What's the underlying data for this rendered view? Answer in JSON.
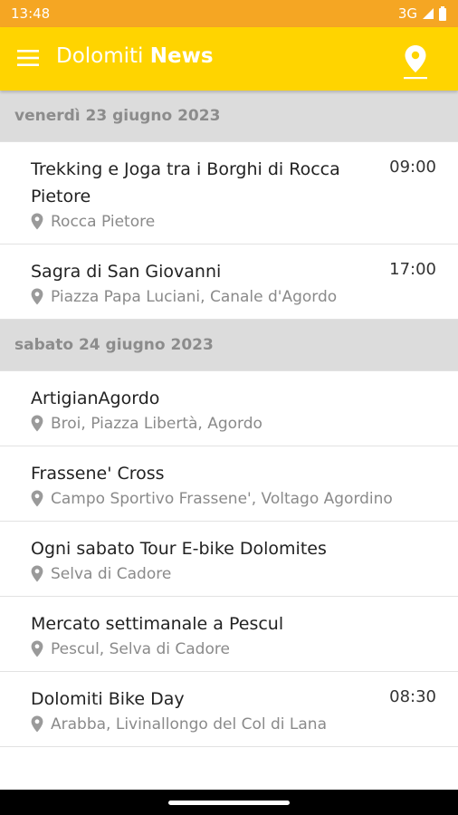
{
  "status_bar": {
    "time": "13:48",
    "network": "3G"
  },
  "app_bar": {
    "title_regular": "Dolomiti",
    "title_bold": "News"
  },
  "colors": {
    "status_bar": "#f5a623",
    "app_bar": "#ffd400",
    "date_header_bg": "#dcdcdc",
    "date_header_text": "#8c8c8c"
  },
  "icons": {
    "menu": "hamburger-menu-icon",
    "location": "location-pin-icon",
    "event_location": "map-marker-icon"
  },
  "sections": [
    {
      "date": "venerdì 23 giugno 2023",
      "events": [
        {
          "title": "Trekking e Joga tra i Borghi di Rocca Pietore",
          "time": "09:00",
          "location": "Rocca Pietore"
        },
        {
          "title": "Sagra di San Giovanni",
          "time": "17:00",
          "location": "Piazza Papa Luciani, Canale d'Agordo"
        }
      ]
    },
    {
      "date": "sabato 24 giugno 2023",
      "events": [
        {
          "title": "ArtigianAgordo",
          "time": "",
          "location": "Broi, Piazza Libertà, Agordo"
        },
        {
          "title": "Frassene' Cross",
          "time": "",
          "location": "Campo Sportivo Frassene', Voltago Agordino"
        },
        {
          "title": "Ogni sabato Tour E-bike Dolomites",
          "time": "",
          "location": "Selva di Cadore"
        },
        {
          "title": "Mercato settimanale a Pescul",
          "time": "",
          "location": "Pescul, Selva di Cadore"
        },
        {
          "title": "Dolomiti Bike Day",
          "time": "08:30",
          "location": "Arabba, Livinallongo del Col di Lana"
        }
      ]
    }
  ]
}
